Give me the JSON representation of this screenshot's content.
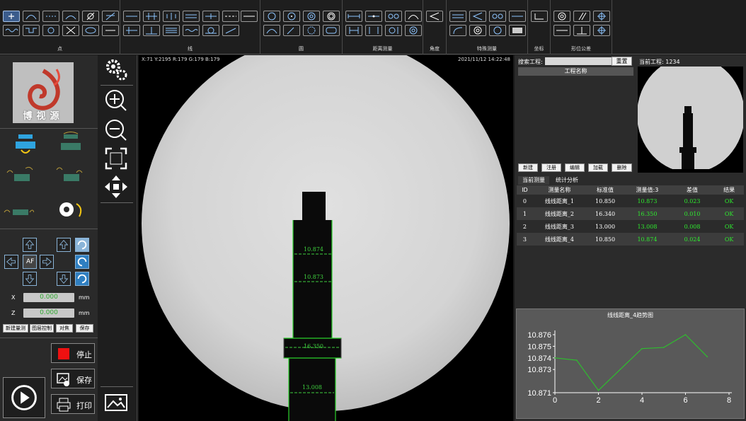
{
  "toolbar": {
    "groups": [
      {
        "label": "点"
      },
      {
        "label": "线"
      },
      {
        "label": "圆"
      },
      {
        "label": "距离测量"
      },
      {
        "label": "角度"
      },
      {
        "label": "特殊测量"
      },
      {
        "label": "坐标"
      },
      {
        "label": "形位公差"
      }
    ]
  },
  "left": {
    "logo_text": "博视源",
    "x_label": "X",
    "x_value": "0.000",
    "x_unit": "mm",
    "z_label": "Z",
    "z_value": "0.000",
    "z_unit": "mm",
    "af_label": "AF",
    "buttons": [
      "新建量测",
      "图层控制",
      "对焦",
      "保存"
    ],
    "stop_label": "停止",
    "save_label": "保存",
    "print_label": "打印"
  },
  "camera": {
    "info": "X:71   Y:2195   R:179  G:179  B:179",
    "datetime": "2021/11/12    14:22:48",
    "measurements": [
      "10.874",
      "10.873",
      "16.350",
      "13.008"
    ]
  },
  "right": {
    "search_label": "搜索工程:",
    "search_placeholder": "",
    "reset_label": "重置",
    "current_project": "当前工程: 1234",
    "project_header": "工程名称",
    "project_buttons": [
      "新建",
      "注册",
      "编辑",
      "加载",
      "删除"
    ],
    "tabs": [
      "当前测量",
      "统计分析"
    ],
    "table": {
      "headers": [
        "ID",
        "测量名称",
        "标准值",
        "测量值:3",
        "差值",
        "结果"
      ],
      "rows": [
        [
          "0",
          "线线距离_1",
          "10.850",
          "10.873",
          "0.023",
          "OK"
        ],
        [
          "1",
          "线线距离_2",
          "16.340",
          "16.350",
          "0.010",
          "OK"
        ],
        [
          "2",
          "线线距离_3",
          "13.000",
          "13.008",
          "0.008",
          "OK"
        ],
        [
          "3",
          "线线距离_4",
          "10.850",
          "10.874",
          "0.024",
          "OK"
        ]
      ]
    }
  },
  "colors": {
    "accent_green": "#3ecf3e",
    "table_green": "#2eea2e"
  },
  "chart_data": {
    "type": "line",
    "title": "线线距离_4趋势图",
    "x": [
      0,
      1,
      2,
      3,
      4,
      5,
      6,
      7
    ],
    "series": [
      {
        "values": [
          10.874,
          10.8738,
          10.8712,
          10.873,
          10.8748,
          10.8749,
          10.876,
          10.8741
        ]
      }
    ],
    "xlim": [
      0,
      8
    ],
    "ylim": [
      10.871,
      10.876
    ],
    "xticks": [
      "0",
      "2",
      "4",
      "6",
      "8"
    ],
    "yticks": [
      "10.871",
      "10.873",
      "10.874",
      "10.875",
      "10.876"
    ],
    "line_color": "#2ebd2e",
    "grid": false
  }
}
